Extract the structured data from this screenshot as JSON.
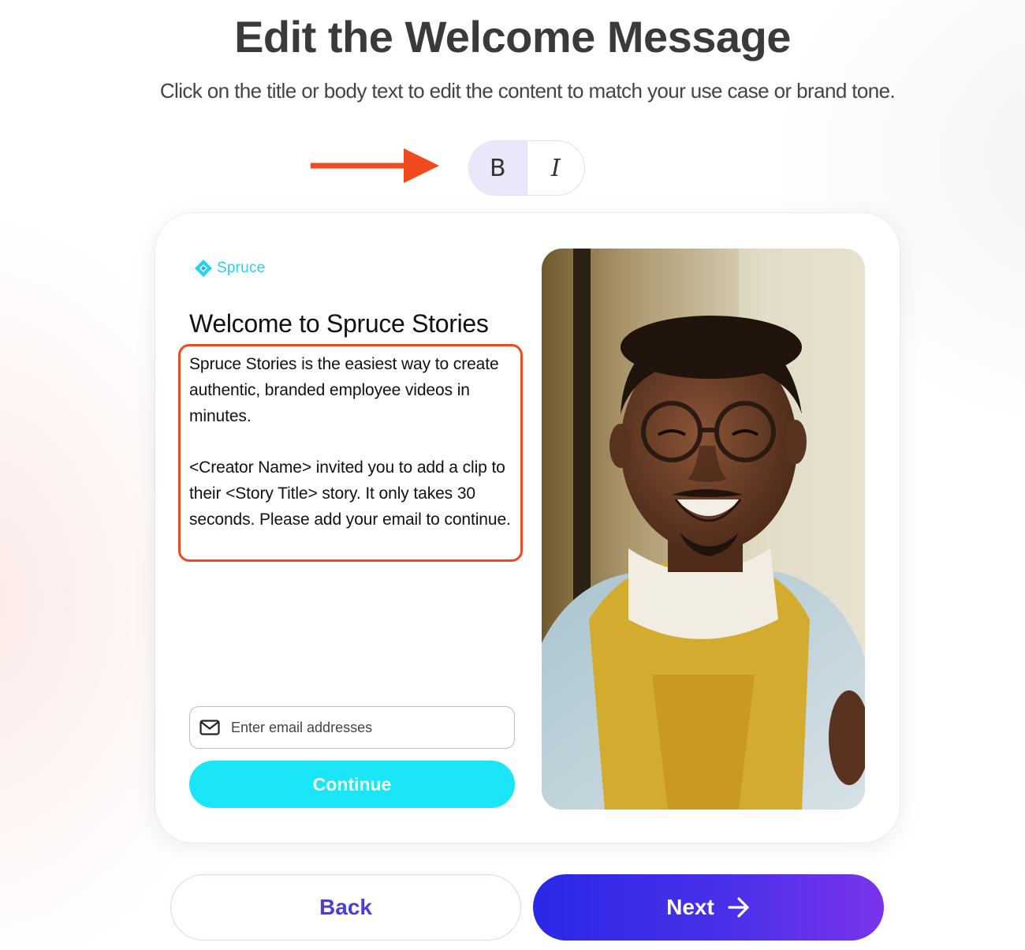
{
  "header": {
    "title": "Edit the Welcome Message",
    "subtitle": "Click on the title or body text to edit the content to match your use case or brand tone."
  },
  "format_toolbar": {
    "bold_label": "B",
    "italic_label": "I",
    "active": "bold"
  },
  "annotation": {
    "arrow_color": "#f04a1e",
    "highlight_color": "#ec4a22"
  },
  "card": {
    "brand": {
      "name": "Spruce",
      "logo_icon": "diamond-logo-icon",
      "color": "#24d4ee"
    },
    "welcome_title": "Welcome to Spruce Stories",
    "body_paragraphs": [
      "Spruce Stories is the easiest way to create authentic, branded employee videos in minutes.",
      "<Creator Name> invited you to add a clip to their <Story Title> story. It only takes 30 seconds. Please add your email to continue."
    ],
    "email_input": {
      "placeholder": "Enter email addresses",
      "value": "",
      "icon": "mail-icon"
    },
    "continue_label": "Continue",
    "continue_color": "#1ae6f7"
  },
  "footer": {
    "back_label": "Back",
    "next_label": "Next",
    "next_icon": "arrow-right-icon"
  }
}
